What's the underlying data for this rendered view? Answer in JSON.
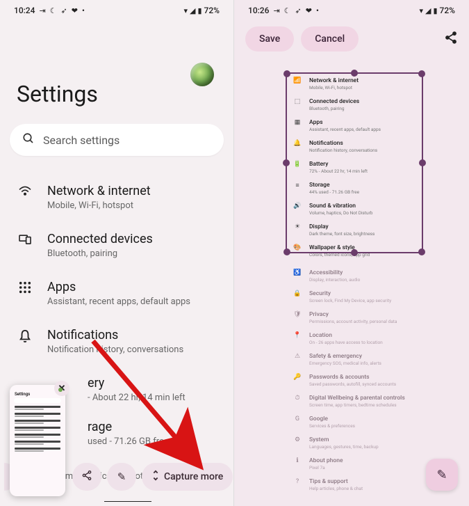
{
  "left": {
    "status": {
      "time": "10:24",
      "battery": "72%"
    },
    "title": "Settings",
    "search_placeholder": "Search settings",
    "items": [
      {
        "title": "Network & internet",
        "sub": "Mobile, Wi-Fi, hotspot"
      },
      {
        "title": "Connected devices",
        "sub": "Bluetooth, pairing"
      },
      {
        "title": "Apps",
        "sub": "Assistant, recent apps, default apps"
      },
      {
        "title": "Notifications",
        "sub": "Notification history, conversations"
      },
      {
        "title_suffix": "ery",
        "sub_suffix": "- About 22 hr, 14 min left"
      },
      {
        "title_suffix": "rage",
        "sub_suffix": "used - 71.26 GB free"
      },
      {
        "sub_suffix": "Volume, haptics, Do Not Disturb"
      }
    ],
    "pills": {
      "capture_more": "Capture more"
    },
    "thumb_title": "Settings"
  },
  "right": {
    "status": {
      "time": "10:26",
      "battery": "72%"
    },
    "save": "Save",
    "cancel": "Cancel",
    "inside": [
      {
        "t": "Network & internet",
        "s": "Mobile, Wi-Fi, hotspot"
      },
      {
        "t": "Connected devices",
        "s": "Bluetooth, pairing"
      },
      {
        "t": "Apps",
        "s": "Assistant, recent apps, default apps"
      },
      {
        "t": "Notifications",
        "s": "Notification history, conversations"
      },
      {
        "t": "Battery",
        "s": "72% - About 22 hr, 14 min left"
      },
      {
        "t": "Storage",
        "s": "44% used - 71.26 GB free"
      },
      {
        "t": "Sound & vibration",
        "s": "Volume, haptics, Do Not Disturb"
      },
      {
        "t": "Display",
        "s": "Dark theme, font size, brightness"
      },
      {
        "t": "Wallpaper & style",
        "s": "Colors, themed icons, app grid"
      }
    ],
    "below": [
      {
        "t": "Accessibility",
        "s": "Display, interaction, audio"
      },
      {
        "t": "Security",
        "s": "Screen lock, Find My Device, app security"
      },
      {
        "t": "Privacy",
        "s": "Permissions, account activity, personal data"
      },
      {
        "t": "Location",
        "s": "On - 26 apps have access to location"
      },
      {
        "t": "Safety & emergency",
        "s": "Emergency SOS, medical info, alerts"
      },
      {
        "t": "Passwords & accounts",
        "s": "Saved passwords, autofill, synced accounts"
      },
      {
        "t": "Digital Wellbeing & parental controls",
        "s": "Screen time, app timers, bedtime schedules"
      },
      {
        "t": "Google",
        "s": "Services & preferences"
      },
      {
        "t": "System",
        "s": "Languages, gestures, time, backup"
      },
      {
        "t": "About phone",
        "s": "Pixel 7a"
      },
      {
        "t": "Tips & support",
        "s": "Help articles, phone & chat"
      }
    ]
  }
}
